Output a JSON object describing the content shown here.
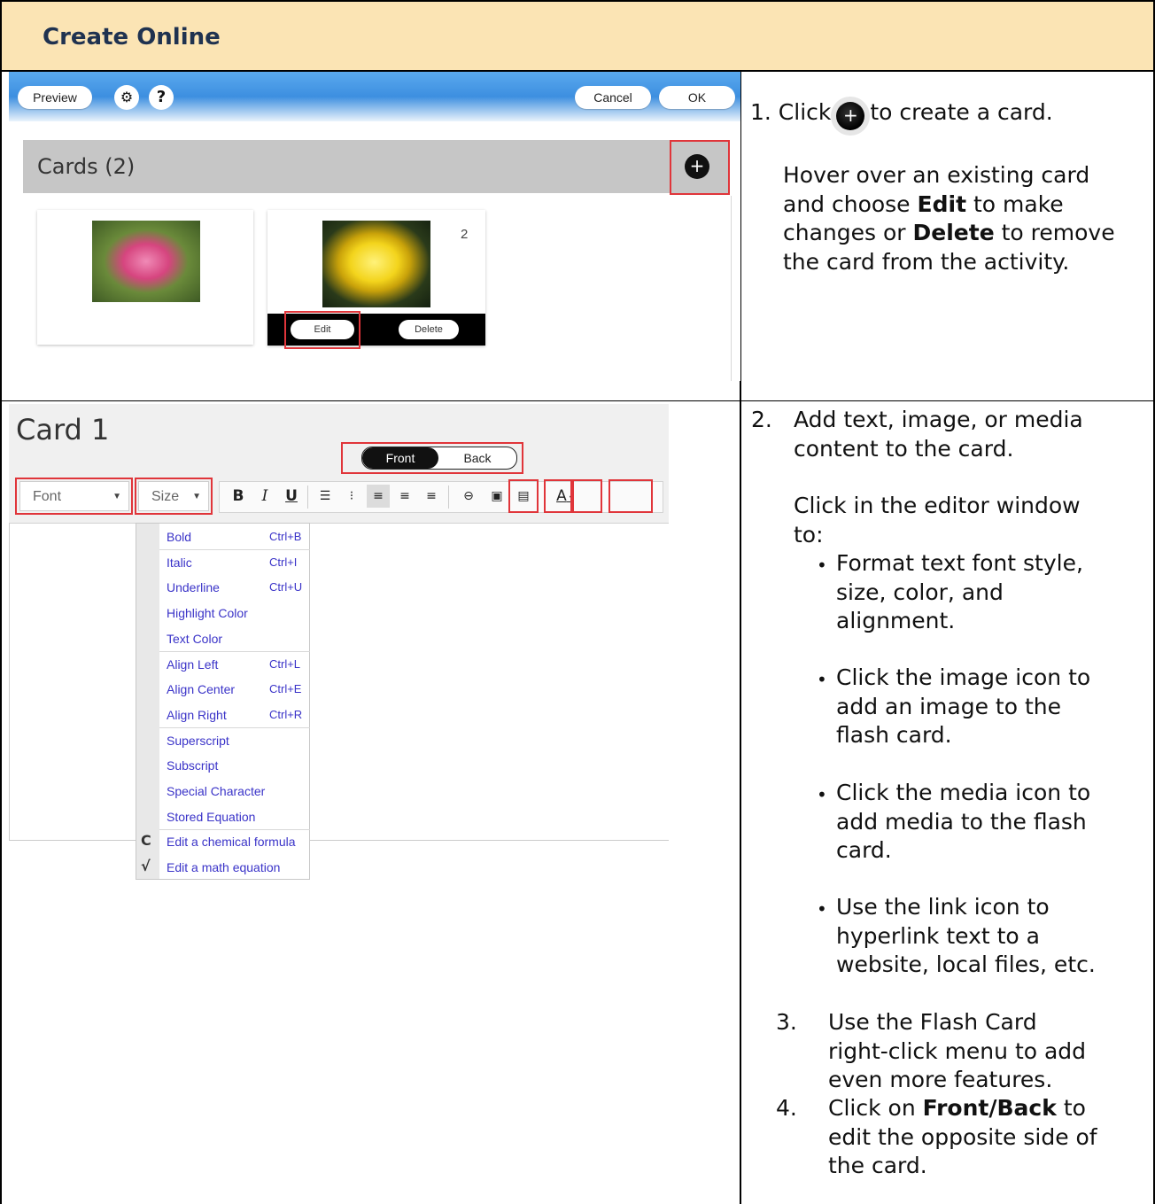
{
  "header": {
    "title": "Create Online"
  },
  "shot1": {
    "preview_label": "Preview",
    "settings_icon": "gear-icon",
    "help_icon": "?",
    "cancel_label": "Cancel",
    "ok_label": "OK",
    "cards_title": "Cards (2)",
    "add_icon": "+",
    "card2_number": "2",
    "edit_label": "Edit",
    "delete_label": "Delete"
  },
  "shot2": {
    "card_title": "Card 1",
    "front_label": "Front",
    "back_label": "Back",
    "font_label": "Font",
    "size_label": "Size",
    "toolbar": {
      "bold": "B",
      "italic": "I",
      "underline": "U",
      "align_icons": [
        "align-left-icon",
        "align-center-icon",
        "align-right-icon"
      ],
      "text_color": "A"
    },
    "menu": [
      {
        "label": "Bold",
        "key": "Ctrl+B"
      },
      {
        "label": "Italic",
        "key": "Ctrl+I"
      },
      {
        "label": "Underline",
        "key": "Ctrl+U"
      },
      {
        "label": "Highlight Color",
        "key": ""
      },
      {
        "label": "Text Color",
        "key": ""
      },
      {
        "label": "Align Left",
        "key": "Ctrl+L"
      },
      {
        "label": "Align Center",
        "key": "Ctrl+E"
      },
      {
        "label": "Align Right",
        "key": "Ctrl+R"
      },
      {
        "label": "Superscript",
        "key": ""
      },
      {
        "label": "Subscript",
        "key": ""
      },
      {
        "label": "Special Character",
        "key": ""
      },
      {
        "label": "Stored Equation",
        "key": ""
      },
      {
        "label": "Edit a chemical formula",
        "key": ""
      },
      {
        "label": "Edit a math equation",
        "key": ""
      }
    ],
    "chem_icon": "C",
    "math_icon": "√"
  },
  "steps": {
    "s1_prefix": "1. Click",
    "s1_suffix": "to create a card.",
    "s1_hover_a": "Hover over an existing card",
    "s1_hover_b": "and choose",
    "s1_edit": "Edit",
    "s1_hover_c": "to make",
    "s1_hover_d": "changes or",
    "s1_delete": "Delete",
    "s1_hover_e": "to remove",
    "s1_hover_f": "the card from the activity.",
    "s2_num": "2.",
    "s2_a": "Add text, image, or media",
    "s2_b": "content to the card.",
    "s2_c": "Click in the editor window",
    "s2_d": "to:",
    "b1_a": "Format text font style,",
    "b1_b": "size, color, and",
    "b1_c": "alignment.",
    "b2_a": "Click the image icon to",
    "b2_b": "add an image to the",
    "b2_c": "flash card.",
    "b3_a": "Click the media icon to",
    "b3_b": "add media to the flash",
    "b3_c": "card.",
    "b4_a": "Use the link icon to",
    "b4_b": "hyperlink text to a",
    "b4_c": "website, local files, etc.",
    "s3_num": "3.",
    "s3_a": "Use the Flash Card",
    "s3_b": "right-click menu to add",
    "s3_c": "even more features.",
    "s4_num": "4.",
    "s4_a": "Click on",
    "s4_bold": "Front/Back",
    "s4_b": "to",
    "s4_c": "edit the opposite side of",
    "s4_d": "the card."
  }
}
